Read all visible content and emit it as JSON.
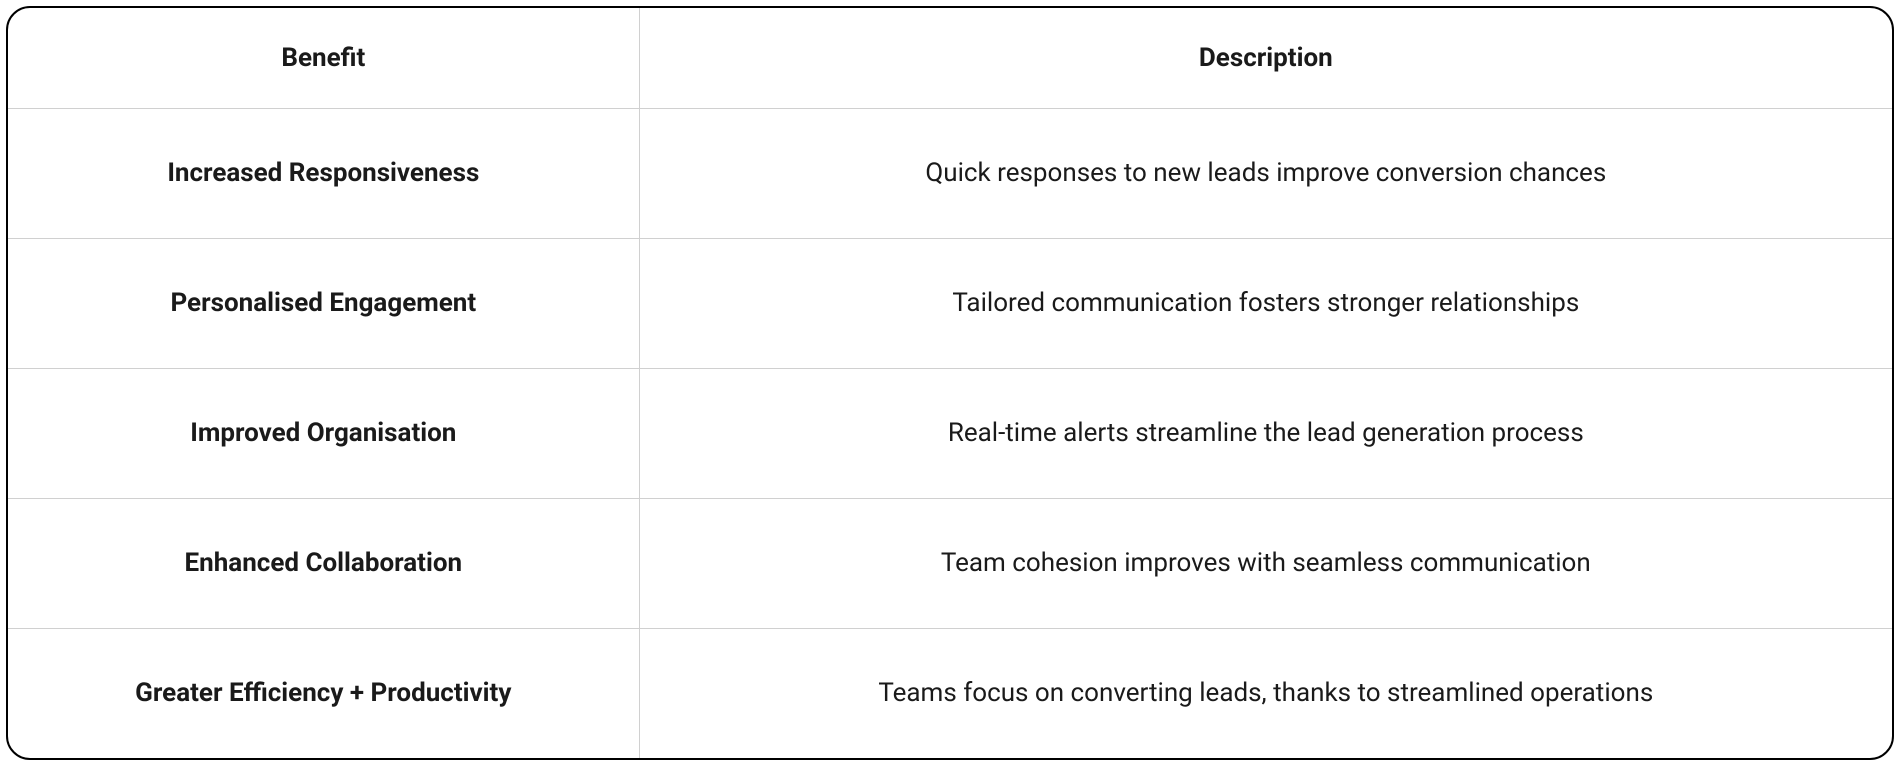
{
  "table": {
    "headers": {
      "benefit": "Benefit",
      "description": "Description"
    },
    "rows": [
      {
        "benefit": "Increased Responsiveness",
        "description": "Quick responses to new leads improve conversion chances"
      },
      {
        "benefit": "Personalised Engagement",
        "description": "Tailored communication fosters stronger relationships"
      },
      {
        "benefit": "Improved Organisation",
        "description": "Real-time alerts streamline the lead generation process"
      },
      {
        "benefit": "Enhanced Collaboration",
        "description": "Team cohesion improves with seamless communication"
      },
      {
        "benefit": "Greater Efficiency + Productivity",
        "description": "Teams focus on converting leads, thanks to streamlined operations"
      }
    ]
  }
}
